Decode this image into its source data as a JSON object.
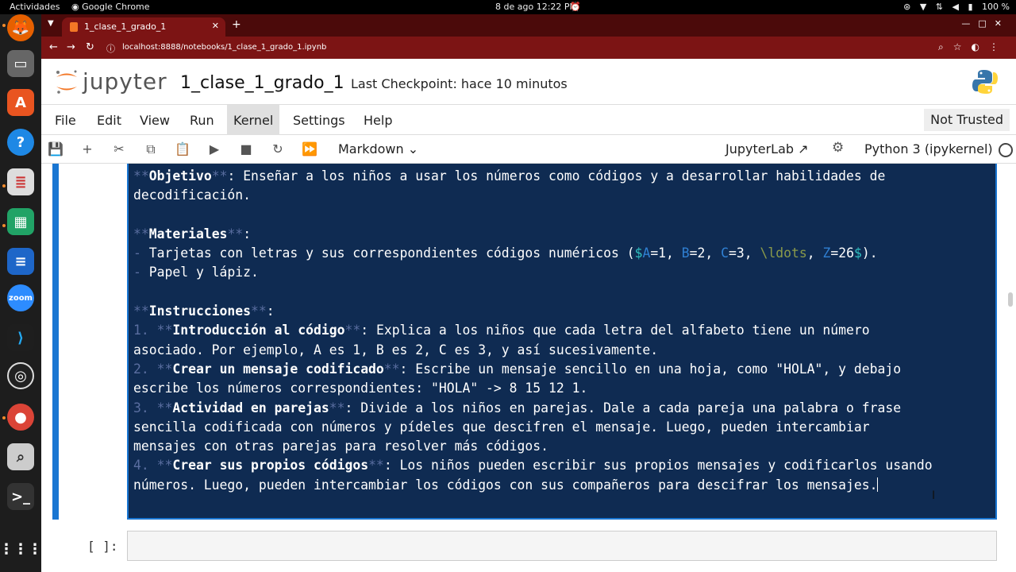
{
  "os": {
    "activities": "Actividades",
    "app": "Google Chrome",
    "clock": "8 de ago  12:22 PM",
    "battery": "100 %"
  },
  "browser": {
    "tab_title": "1_clase_1_grado_1",
    "url": "localhost:8888/notebooks/1_clase_1_grado_1.ipynb"
  },
  "jupyter": {
    "brand": "jupyter",
    "notebook_name": "1_clase_1_grado_1",
    "checkpoint": "Last Checkpoint: hace 10 minutos",
    "menus": [
      "File",
      "Edit",
      "View",
      "Run",
      "Kernel",
      "Settings",
      "Help"
    ],
    "trust": "Not Trusted",
    "cell_type": "Markdown",
    "jupyterlab": "JupyterLab",
    "kernel": "Python 3 (ipykernel)"
  },
  "cell": {
    "l1_a": "**",
    "l1_b": "Objetivo",
    "l1_c": "**",
    "l1_d": ": Enseñar a los niños a usar los números como códigos y a desarrollar habilidades de",
    "l2": "decodificación.",
    "l4_a": "**",
    "l4_b": "Materiales",
    "l4_c": "**",
    "l4_d": ":",
    "l5_a": "-",
    "l5_b": " Tarjetas con letras y sus correspondientes códigos numéricos (",
    "l5_c": "$",
    "l5_d": "A",
    "l5_e": "=1, ",
    "l5_f": "B",
    "l5_g": "=2, ",
    "l5_h": "C",
    "l5_i": "=3, ",
    "l5_j": "\\ldots",
    "l5_k": ", ",
    "l5_l": "Z",
    "l5_m": "=26",
    "l5_n": "$",
    "l5_o": ").",
    "l6_a": "-",
    "l6_b": " Papel y lápiz.",
    "l8_a": "**",
    "l8_b": "Instrucciones",
    "l8_c": "**",
    "l8_d": ":",
    "l9_a": "1.",
    "l9_b": " **",
    "l9_c": "Introducción al código",
    "l9_d": "**",
    "l9_e": ": Explica a los niños que cada letra del alfabeto tiene un número",
    "l10": "asociado. Por ejemplo, A es 1, B es 2, C es 3, y así sucesivamente.",
    "l11_a": "2.",
    "l11_b": " **",
    "l11_c": "Crear un mensaje codificado",
    "l11_d": "**",
    "l11_e": ": Escribe un mensaje sencillo en una hoja, como \"HOLA\", y debajo",
    "l12": "escribe los números correspondientes: \"HOLA\" -> 8 15 12 1.",
    "l13_a": "3.",
    "l13_b": " **",
    "l13_c": "Actividad en parejas",
    "l13_d": "**",
    "l13_e": ": Divide a los niños en parejas. Dale a cada pareja una palabra o frase",
    "l14": "sencilla codificada con números y pídeles que descifren el mensaje. Luego, pueden intercambiar",
    "l15": "mensajes con otras parejas para resolver más códigos.",
    "l16_a": "4.",
    "l16_b": " **",
    "l16_c": "Crear sus propios códigos",
    "l16_d": "**",
    "l16_e": ": Los niños pueden escribir sus propios mensajes y codificarlos usando",
    "l17": "números. Luego, pueden intercambiar los códigos con sus compañeros para descifrar los mensajes."
  },
  "next_cell": {
    "prompt": "[ ]:"
  }
}
